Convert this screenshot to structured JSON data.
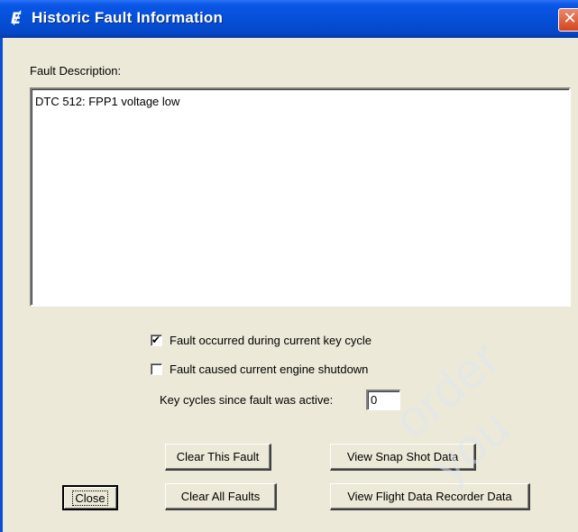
{
  "window": {
    "title": "Historic Fault Information",
    "close_symbol": "✕",
    "icon": "app-logo-icon"
  },
  "fault_description": {
    "label": "Fault Description:",
    "text": "DTC 512: FPP1 voltage low"
  },
  "checkboxes": [
    {
      "label": "Fault occurred during current key cycle",
      "checked": true
    },
    {
      "label": "Fault caused current engine shutdown",
      "checked": false
    }
  ],
  "key_cycles": {
    "label": "Key cycles since fault was active:",
    "value": "0"
  },
  "buttons": {
    "close": "Close",
    "clear_this_fault": "Clear This Fault",
    "clear_all_faults": "Clear All Faults",
    "view_snapshot": "View Snap Shot Data",
    "view_flight_recorder": "View Flight Data Recorder Data"
  },
  "watermark_text": "order you"
}
